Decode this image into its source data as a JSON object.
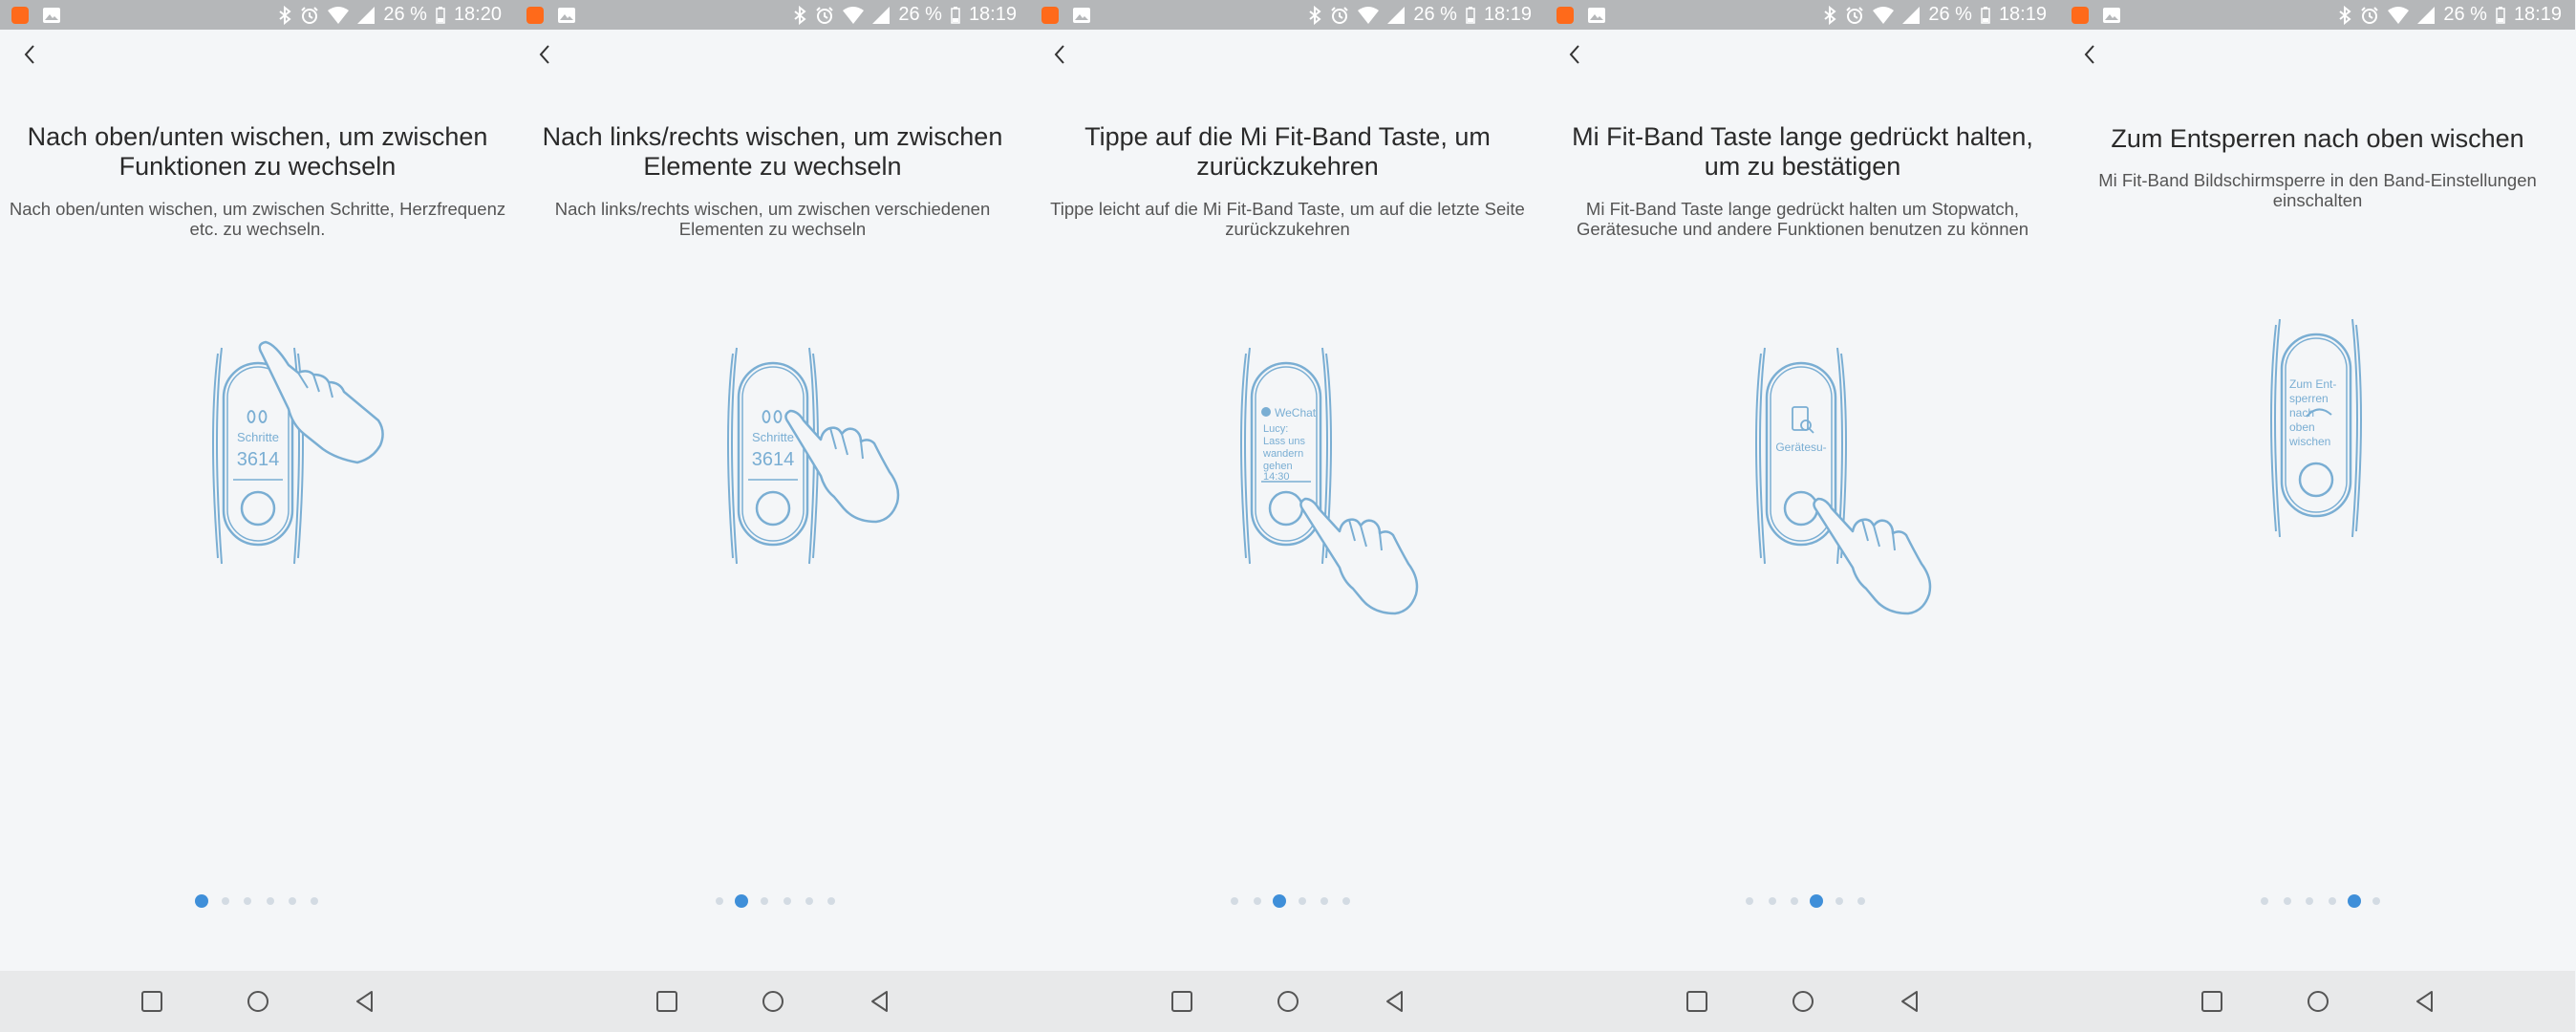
{
  "colors": {
    "accent": "#3f8fd9",
    "illustration": "#7aaed3",
    "status_bar": "#b5b7b9",
    "nav_bar": "#e8e9ea"
  },
  "panels": [
    {
      "status": {
        "battery": "26 %",
        "time": "18:20"
      },
      "title": "Nach oben/unten wischen, um zwischen Funktionen zu wechseln",
      "subtitle": "Nach oben/unten wischen, um zwischen Schritte, Herzfrequenz etc. zu wechseln.",
      "band": {
        "label": "Schritte",
        "value": "3614"
      },
      "active_page": 0
    },
    {
      "status": {
        "battery": "26 %",
        "time": "18:19"
      },
      "title": "Nach links/rechts wischen, um zwischen Elemente zu wechseln",
      "subtitle": "Nach links/rechts wischen, um zwischen verschiedenen Elementen zu wechseln",
      "band": {
        "label": "Schritte",
        "value": "3614"
      },
      "active_page": 1
    },
    {
      "status": {
        "battery": "26 %",
        "time": "18:19"
      },
      "title": "Tippe auf die Mi Fit-Band Taste, um zurückzukehren",
      "subtitle": "Tippe leicht auf die Mi Fit-Band Taste, um auf die letzte Seite zurückzukehren",
      "band": {
        "app": "WeChat",
        "lines": [
          "Lucy:",
          "Lass uns",
          "wandern",
          "gehen"
        ],
        "time": "14:30"
      },
      "active_page": 2
    },
    {
      "status": {
        "battery": "26 %",
        "time": "18:19"
      },
      "title": "Mi Fit-Band Taste lange gedrückt halten, um zu bestätigen",
      "subtitle": "Mi Fit-Band Taste lange gedrückt halten um Stopwatch, Gerätesuche und andere Funktionen benutzen zu können",
      "band": {
        "label": "Gerätesu-",
        "icon": "device-search-icon"
      },
      "active_page": 3
    },
    {
      "status": {
        "battery": "26 %",
        "time": "18:19"
      },
      "title": "Zum Entsperren nach oben wischen",
      "subtitle": "Mi Fit-Band Bildschirmsperre in den Band-Einstellungen einschalten",
      "band": {
        "lines": [
          "Zum Ent-",
          "sperren",
          "nach",
          "oben",
          "wischen"
        ]
      },
      "active_page": 4
    }
  ],
  "page_count": 6
}
